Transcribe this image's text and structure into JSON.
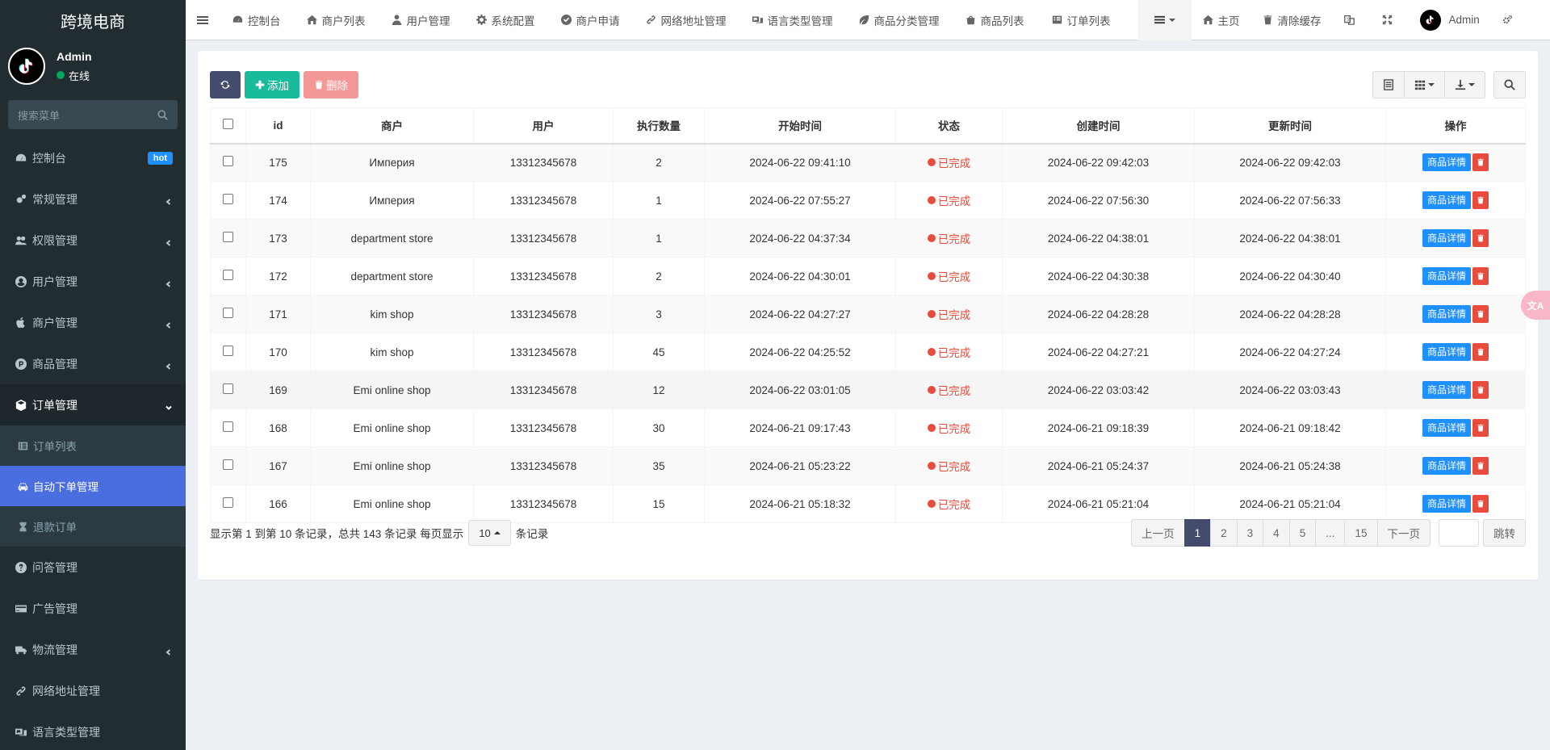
{
  "brand": "跨境电商",
  "user": {
    "name": "Admin",
    "status": "在线"
  },
  "sidebar": {
    "search_placeholder": "搜索菜单",
    "items": [
      {
        "label": "控制台",
        "icon": "dashboard-icon",
        "badge": "hot"
      },
      {
        "label": "常规管理",
        "icon": "cogs-icon"
      },
      {
        "label": "权限管理",
        "icon": "group-icon"
      },
      {
        "label": "用户管理",
        "icon": "user-circle-icon"
      },
      {
        "label": "商户管理",
        "icon": "apple-icon"
      },
      {
        "label": "商品管理",
        "icon": "product-hunt-icon"
      },
      {
        "label": "订单管理",
        "icon": "cube-icon"
      }
    ],
    "order_sub": [
      {
        "label": "订单列表",
        "icon": "list-alt-icon"
      },
      {
        "label": "自动下单管理",
        "icon": "car-icon"
      },
      {
        "label": "退款订单",
        "icon": "hourglass-icon"
      }
    ],
    "items_after": [
      {
        "label": "问答管理",
        "icon": "question-circle-icon"
      },
      {
        "label": "广告管理",
        "icon": "credit-card-icon"
      },
      {
        "label": "物流管理",
        "icon": "truck-icon"
      },
      {
        "label": "网络地址管理",
        "icon": "link-icon"
      },
      {
        "label": "语言类型管理",
        "icon": "language-icon"
      }
    ]
  },
  "topbar": {
    "tabs": [
      "控制台",
      "商户列表",
      "用户管理",
      "系统配置",
      "商户申请",
      "网络地址管理",
      "语言类型管理",
      "商品分类管理",
      "商品列表",
      "订单列表"
    ],
    "home": "主页",
    "clear_cache": "清除缓存",
    "admin": "Admin"
  },
  "toolbar": {
    "add": "添加",
    "delete": "删除"
  },
  "table": {
    "headers": [
      "id",
      "商户",
      "用户",
      "执行数量",
      "开始时间",
      "状态",
      "创建时间",
      "更新时间",
      "操作"
    ],
    "detail_label": "商品详情",
    "rows": [
      {
        "id": "175",
        "merchant": "Империя",
        "user": "13312345678",
        "qty": "2",
        "start": "2024-06-22 09:41:10",
        "status": "已完成",
        "created": "2024-06-22 09:42:03",
        "updated": "2024-06-22 09:42:03"
      },
      {
        "id": "174",
        "merchant": "Империя",
        "user": "13312345678",
        "qty": "1",
        "start": "2024-06-22 07:55:27",
        "status": "已完成",
        "created": "2024-06-22 07:56:30",
        "updated": "2024-06-22 07:56:33"
      },
      {
        "id": "173",
        "merchant": "department store",
        "user": "13312345678",
        "qty": "1",
        "start": "2024-06-22 04:37:34",
        "status": "已完成",
        "created": "2024-06-22 04:38:01",
        "updated": "2024-06-22 04:38:01"
      },
      {
        "id": "172",
        "merchant": "department store",
        "user": "13312345678",
        "qty": "2",
        "start": "2024-06-22 04:30:01",
        "status": "已完成",
        "created": "2024-06-22 04:30:38",
        "updated": "2024-06-22 04:30:40"
      },
      {
        "id": "171",
        "merchant": "kim shop",
        "user": "13312345678",
        "qty": "3",
        "start": "2024-06-22 04:27:27",
        "status": "已完成",
        "created": "2024-06-22 04:28:28",
        "updated": "2024-06-22 04:28:28"
      },
      {
        "id": "170",
        "merchant": "kim shop",
        "user": "13312345678",
        "qty": "45",
        "start": "2024-06-22 04:25:52",
        "status": "已完成",
        "created": "2024-06-22 04:27:21",
        "updated": "2024-06-22 04:27:24"
      },
      {
        "id": "169",
        "merchant": "Emi online shop",
        "user": "13312345678",
        "qty": "12",
        "start": "2024-06-22 03:01:05",
        "status": "已完成",
        "created": "2024-06-22 03:03:42",
        "updated": "2024-06-22 03:03:43"
      },
      {
        "id": "168",
        "merchant": "Emi online shop",
        "user": "13312345678",
        "qty": "30",
        "start": "2024-06-21 09:17:43",
        "status": "已完成",
        "created": "2024-06-21 09:18:39",
        "updated": "2024-06-21 09:18:42"
      },
      {
        "id": "167",
        "merchant": "Emi online shop",
        "user": "13312345678",
        "qty": "35",
        "start": "2024-06-21 05:23:22",
        "status": "已完成",
        "created": "2024-06-21 05:24:37",
        "updated": "2024-06-21 05:24:38"
      },
      {
        "id": "166",
        "merchant": "Emi online shop",
        "user": "13312345678",
        "qty": "15",
        "start": "2024-06-21 05:18:32",
        "status": "已完成",
        "created": "2024-06-21 05:21:04",
        "updated": "2024-06-21 05:21:04"
      }
    ]
  },
  "footer": {
    "info": "显示第 1 到第 10 条记录，总共 143 条记录 每页显示",
    "page_size": "10",
    "suffix": "条记录",
    "prev": "上一页",
    "pages": [
      "1",
      "2",
      "3",
      "4",
      "5",
      "...",
      "15"
    ],
    "next": "下一页",
    "jump": "跳转"
  },
  "translate_badge": "文A",
  "colors": {
    "sidebar": "#222d32",
    "active": "#4a6ee0",
    "add": "#18bc9c",
    "delete": "#f49797",
    "detail": "#1e90ff",
    "danger": "#e74c3c"
  }
}
